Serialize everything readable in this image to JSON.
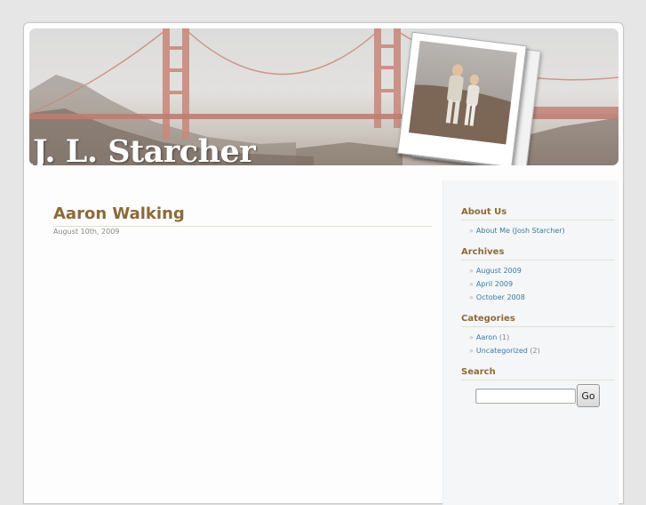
{
  "site": {
    "title": "J. L. Starcher"
  },
  "post": {
    "title": "Aaron Walking",
    "date": "August 10th, 2009"
  },
  "sidebar": {
    "about": {
      "heading": "About Us",
      "items": [
        {
          "label": "About Me (Josh Starcher)"
        }
      ]
    },
    "archives": {
      "heading": "Archives",
      "items": [
        {
          "label": "August 2009"
        },
        {
          "label": "April 2009"
        },
        {
          "label": "October 2008"
        }
      ]
    },
    "categories": {
      "heading": "Categories",
      "items": [
        {
          "label": "Aaron",
          "count": "(1)"
        },
        {
          "label": "Uncategorized",
          "count": "(2)"
        }
      ]
    },
    "search": {
      "heading": "Search",
      "button_label": "Go",
      "value": ""
    }
  },
  "colors": {
    "accent": "#8b6a3a",
    "link": "#3a7aa5",
    "page_bg": "#e6e6e6"
  },
  "icons": {
    "list_bullet": "raquo-bullet"
  }
}
